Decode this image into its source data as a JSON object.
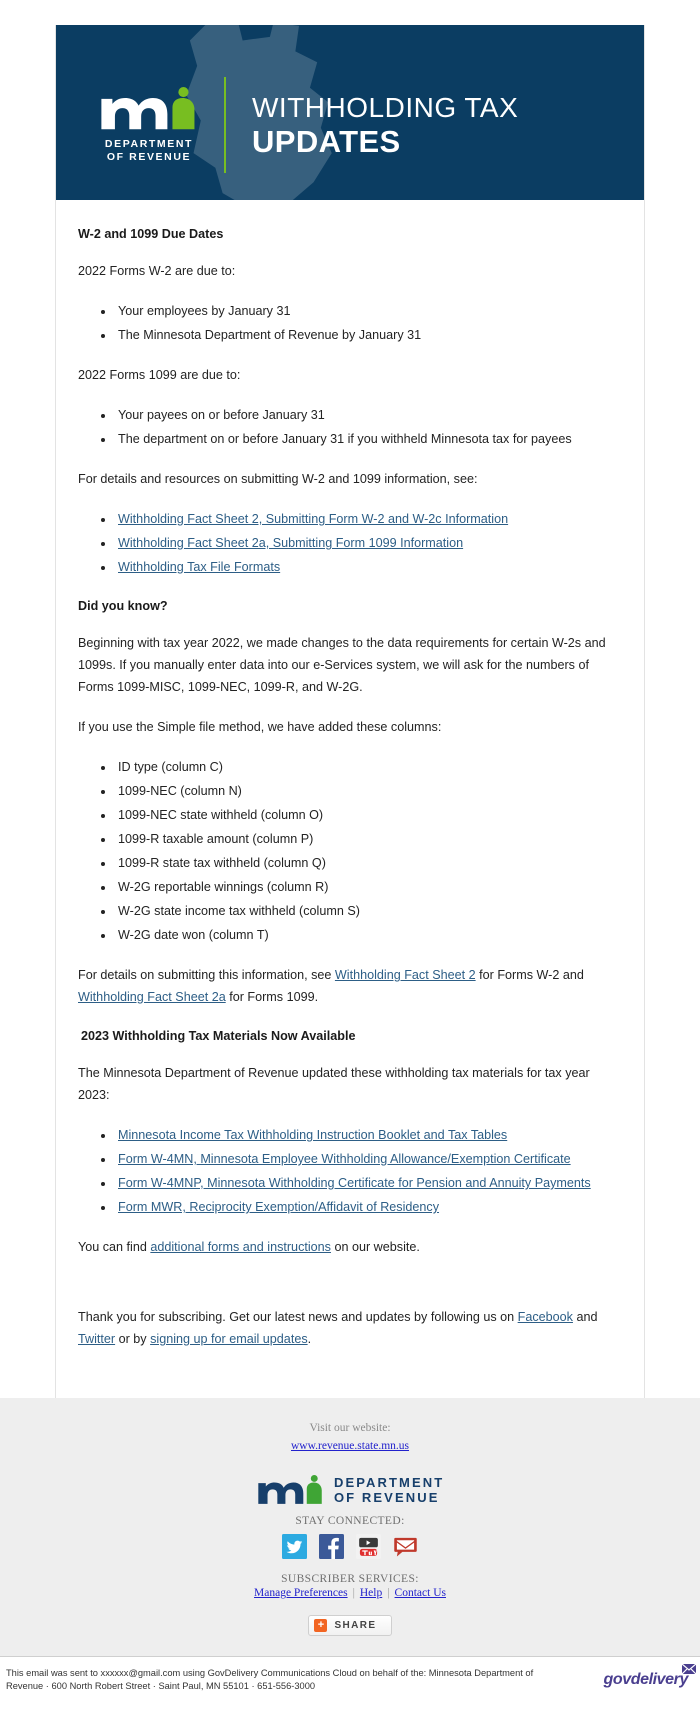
{
  "banner": {
    "logo_dept_line1": "DEPARTMENT",
    "logo_dept_line2": "OF REVENUE",
    "title_line1": "WITHHOLDING TAX",
    "title_line2": "UPDATES",
    "bg_color": "#0b3d62",
    "accent_color": "#78be21"
  },
  "article": {
    "heading1": "W-2 and 1099 Due Dates",
    "p1": "2022 Forms W-2 are due to:",
    "list1": [
      "Your employees by January 31",
      "The Minnesota Department of Revenue by January 31"
    ],
    "p2": "2022 Forms 1099 are due to:",
    "list2": [
      "Your payees on or before January 31",
      "The department on or before January 31 if you withheld Minnesota tax for payees"
    ],
    "p3": "For details and resources on submitting W-2 and 1099 information, see:",
    "list3": [
      "Withholding Fact Sheet 2, Submitting Form W-2 and W-2c Information",
      "Withholding Fact Sheet 2a, Submitting Form 1099 Information",
      "Withholding Tax File Formats"
    ],
    "heading2": "Did you know?",
    "p4": "Beginning with tax year 2022, we made changes to the data requirements for certain W-2s and 1099s. If you manually enter data into our e-Services system, we will ask for the numbers of Forms 1099-MISC, 1099-NEC, 1099-R, and W-2G.",
    "p5": "If you use the Simple file method, we have added these columns:",
    "list4": [
      "ID type (column C)",
      "1099-NEC (column N)",
      "1099-NEC state withheld (column O)",
      "1099-R taxable amount (column P)",
      "1099-R state tax withheld (column Q)",
      "W-2G reportable winnings (column R)",
      "W-2G state income tax withheld (column S)",
      "W-2G date won (column T)"
    ],
    "p6_part1": "For details on submitting this information, see ",
    "p6_link1": "Withholding Fact Sheet 2",
    "p6_part2": " for Forms W-2 and ",
    "p6_link2": "Withholding Fact Sheet 2a",
    "p6_part3": " for Forms 1099.",
    "heading3": "2023 Withholding Tax Materials Now Available",
    "p7": "The Minnesota Department of Revenue updated these withholding tax materials for tax year 2023:",
    "list5": [
      "Minnesota Income Tax Withholding Instruction Booklet and Tax Tables",
      "Form W-4MN, Minnesota Employee Withholding Allowance/Exemption Certificate",
      "Form W-4MNP, Minnesota Withholding Certificate for Pension and Annuity Payments",
      "Form MWR, Reciprocity Exemption/Affidavit of Residency"
    ],
    "p8_part1": "You can find ",
    "p8_link": "additional forms and instructions",
    "p8_part2": " on our website.",
    "p9_part1": "Thank you for subscribing. Get our latest news and updates by following us on ",
    "p9_link1": "Facebook",
    "p9_part2": " and ",
    "p9_link2": "Twitter",
    "p9_part3": " or by ",
    "p9_link3": "signing up for email updates",
    "p9_part4": "."
  },
  "footer": {
    "visit_label": "Visit our website:",
    "visit_url": "www.revenue.state.mn.us",
    "logo_line1": "DEPARTMENT",
    "logo_line2": "OF REVENUE",
    "stay_connected": "STAY CONNECTED:",
    "social": [
      {
        "name": "twitter",
        "label": "Twitter"
      },
      {
        "name": "facebook",
        "label": "Facebook"
      },
      {
        "name": "youtube",
        "label": "YouTube"
      },
      {
        "name": "email",
        "label": "Email"
      }
    ],
    "subscriber_label": "SUBSCRIBER SERVICES:",
    "sub_links": [
      "Manage Preferences",
      "Help",
      "Contact Us"
    ],
    "share_label": "SHARE",
    "share_plus": "+"
  },
  "bottom": {
    "line1": "This email was sent to xxxxxx@gmail.com using GovDelivery Communications Cloud on behalf of the: Minnesota Department of",
    "line2": "Revenue · 600 North Robert Street · Saint Paul, MN 55101 · 651-556-3000",
    "brand": "govdelivery"
  }
}
